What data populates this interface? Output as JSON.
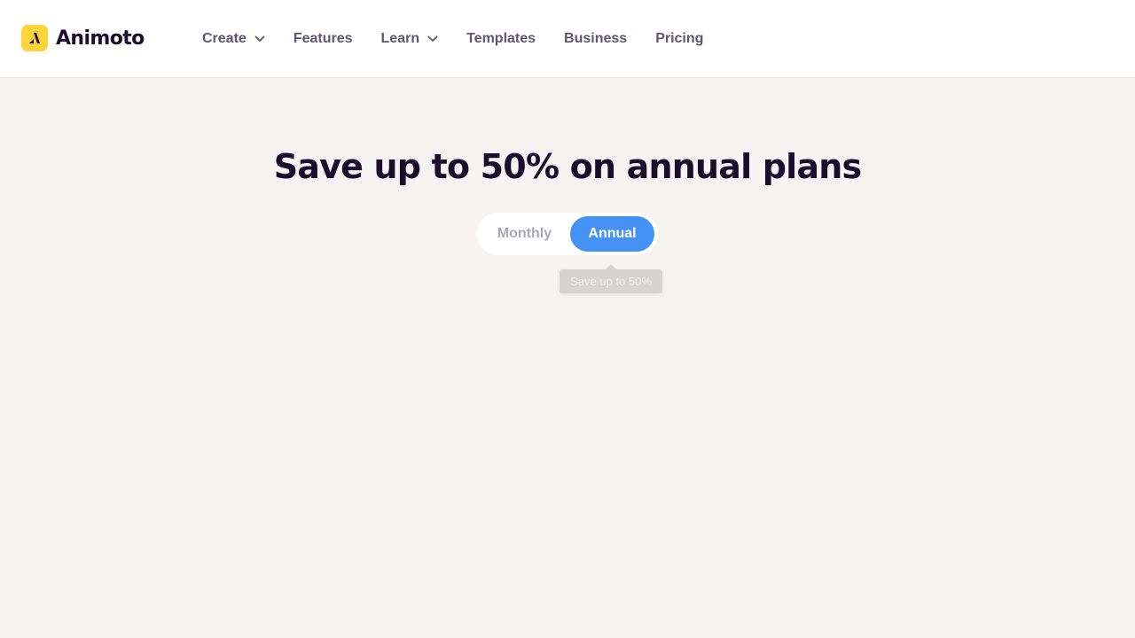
{
  "brand": {
    "name": "Animoto",
    "logo_color": "#ffd43b",
    "icon": "animoto-logo-icon"
  },
  "nav": {
    "items": [
      {
        "label": "Create",
        "has_dropdown": true
      },
      {
        "label": "Features",
        "has_dropdown": false
      },
      {
        "label": "Learn",
        "has_dropdown": true
      },
      {
        "label": "Templates",
        "has_dropdown": false
      },
      {
        "label": "Business",
        "has_dropdown": false
      },
      {
        "label": "Pricing",
        "has_dropdown": false
      }
    ]
  },
  "hero": {
    "title": "Save up to 50% on annual plans"
  },
  "billing_toggle": {
    "options": [
      "Monthly",
      "Annual"
    ],
    "selected": "Annual",
    "active_color": "#4592f5"
  },
  "tooltip": {
    "text": "Save up to 50%"
  }
}
